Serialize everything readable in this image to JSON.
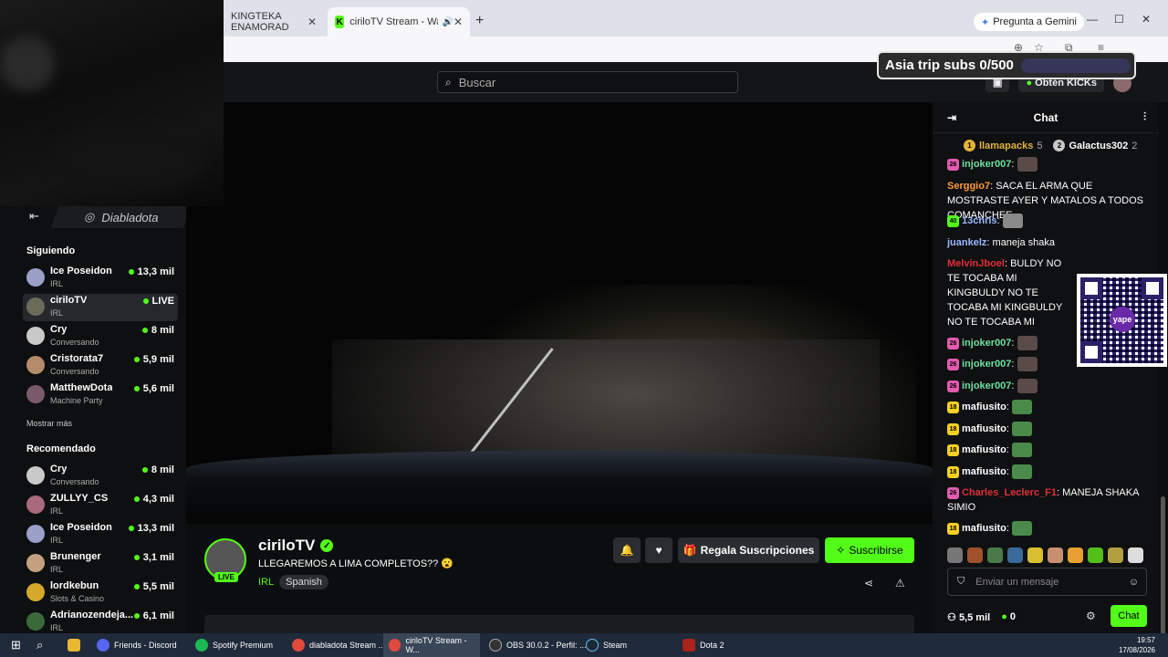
{
  "browser": {
    "tabs": [
      {
        "label": "KINGTEKA ENAMORAD",
        "close": "✕"
      },
      {
        "label": "ciriloTV Stream - Watch Liv",
        "close": "✕"
      }
    ],
    "new_tab": "+",
    "gemini": "Pregunta a Gemini",
    "window_controls": [
      "—",
      "☐",
      "✕"
    ]
  },
  "overlay": {
    "sub_goal": "Asia trip subs 0/500",
    "sub_goal_progress": 0
  },
  "topbar": {
    "search_placeholder": "Buscar",
    "get_kicks": "Obtén KICKs"
  },
  "sidebar": {
    "instagram": "Diabladota",
    "following_title": "Siguiendo",
    "following": [
      {
        "name": "Ice Poseidon",
        "category": "IRL",
        "viewers": "13,3 mil"
      },
      {
        "name": "ciriloTV",
        "category": "IRL",
        "viewers": "LIVE"
      },
      {
        "name": "Cry",
        "category": "Conversando",
        "viewers": "8 mil"
      },
      {
        "name": "Cristorata7",
        "category": "Conversando",
        "viewers": "5,9 mil"
      },
      {
        "name": "MatthewDota",
        "category": "Machine Party",
        "viewers": "5,6 mil"
      }
    ],
    "show_more": "Mostrar más",
    "recommended_title": "Recomendado",
    "recommended": [
      {
        "name": "Cry",
        "category": "Conversando",
        "viewers": "8 mil"
      },
      {
        "name": "ZULLYY_CS",
        "category": "IRL",
        "viewers": "4,3 mil"
      },
      {
        "name": "Ice Poseidon",
        "category": "IRL",
        "viewers": "13,3 mil"
      },
      {
        "name": "Brunenger",
        "category": "IRL",
        "viewers": "3,1 mil"
      },
      {
        "name": "lordkebun",
        "category": "Slots & Casino",
        "viewers": "5,5 mil"
      },
      {
        "name": "Adrianozendeja...",
        "category": "IRL",
        "viewers": "6,1 mil"
      }
    ]
  },
  "stream": {
    "streamer": "ciriloTV",
    "live_badge": "LIVE",
    "title": "LLEGAREMOS A LIMA COMPLETOS?? 😮",
    "category": "IRL",
    "language": "Spanish",
    "gift_label": "Regala Suscripciones",
    "subscribe_label": "Suscribirse"
  },
  "chat": {
    "title": "Chat",
    "pinned": [
      {
        "rank": "1",
        "name": "llamapacks",
        "count": "5"
      },
      {
        "rank": "2",
        "name": "Galactus302",
        "count": "2"
      }
    ],
    "messages": [
      {
        "badge": "26",
        "user": "injoker007",
        "text": ""
      },
      {
        "badge": "",
        "user": "Serggio7",
        "text": "SACA EL ARMA QUE MOSTRASTE AYER Y MATALOS A TODOS COMANCHEE"
      },
      {
        "badge": "40",
        "user": "13chris",
        "text": ""
      },
      {
        "badge": "",
        "user": "juankelz",
        "text": "maneja shaka"
      },
      {
        "badge": "",
        "user": "MelvinJboel",
        "text": "BULDY NO TE TOCABA MI KINGBULDY NO TE TOCABA MI KINGBULDY NO TE TOCABA MI KINGBULDY NO TE TOCABA MI KINGBULDY NO TE TOCABA MI KINGBULDY NO TE TOCABA"
      },
      {
        "badge": "26",
        "user": "injoker007",
        "text": ""
      },
      {
        "badge": "26",
        "user": "injoker007",
        "text": ""
      },
      {
        "badge": "26",
        "user": "injoker007",
        "text": ""
      },
      {
        "badge": "18",
        "user": "mafiusito",
        "text": ""
      },
      {
        "badge": "18",
        "user": "mafiusito",
        "text": ""
      },
      {
        "badge": "18",
        "user": "mafiusito",
        "text": ""
      },
      {
        "badge": "18",
        "user": "mafiusito",
        "text": ""
      },
      {
        "badge": "26",
        "user": "Charles_Leclerc_F1",
        "text": "MANEJA SHAKA SIMIO"
      },
      {
        "badge": "18",
        "user": "mafiusito",
        "text": ""
      }
    ],
    "input_placeholder": "Enviar un mensaje",
    "viewers": "5,5 mil",
    "kicks": "0",
    "send_label": "Chat"
  },
  "taskbar": {
    "apps": [
      {
        "label": "Friends - Discord"
      },
      {
        "label": "Spotify Premium"
      },
      {
        "label": "diabladota Stream ..."
      },
      {
        "label": "ciriloTV Stream - W..."
      },
      {
        "label": "OBS 30.0.2 - Perfil: ..."
      },
      {
        "label": "Steam"
      },
      {
        "label": "Dota 2"
      }
    ],
    "time": "19:57",
    "date": "17/08/2026"
  }
}
